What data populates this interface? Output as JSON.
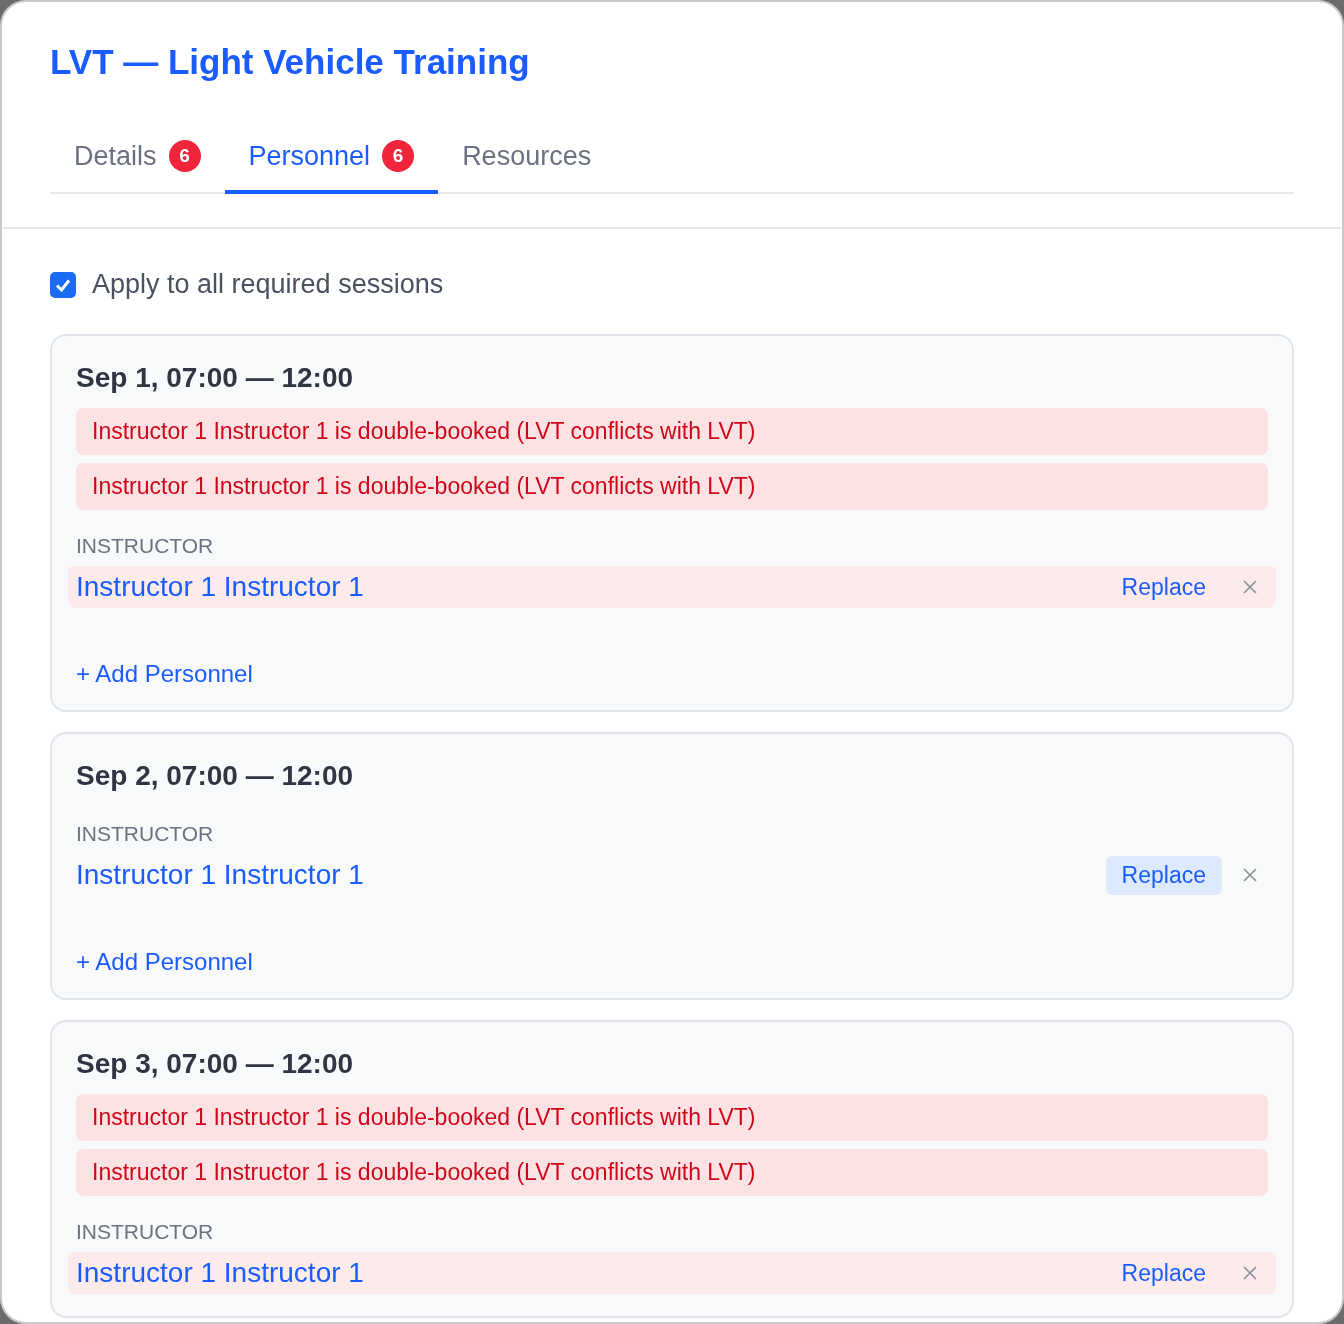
{
  "title": "LVT — Light Vehicle Training",
  "tabs": [
    {
      "label": "Details",
      "badge": "6",
      "selected": false
    },
    {
      "label": "Personnel",
      "badge": "6",
      "selected": true
    },
    {
      "label": "Resources",
      "selected": false
    }
  ],
  "apply_all": {
    "label": "Apply to all required sessions",
    "checked": true
  },
  "sessions": [
    {
      "date": "Sep 1, 07:00 — 12:00",
      "alerts": [
        "Instructor 1 Instructor 1 is double-booked (LVT conflicts with LVT)",
        "Instructor 1 Instructor 1 is double-booked (LVT conflicts with LVT)"
      ],
      "role": "INSTRUCTOR",
      "person": {
        "name": "Instructor 1 Instructor 1",
        "conflict": true,
        "replace": "Replace",
        "replace_hovered": false
      },
      "add": "+ Add Personnel"
    },
    {
      "date": "Sep 2, 07:00 — 12:00",
      "role": "INSTRUCTOR",
      "person": {
        "name": "Instructor 1 Instructor 1",
        "conflict": false,
        "replace": "Replace",
        "replace_hovered": true
      },
      "add": "+ Add Personnel"
    },
    {
      "date": "Sep 3, 07:00 — 12:00",
      "alerts": [
        "Instructor 1 Instructor 1 is double-booked (LVT conflicts with LVT)",
        "Instructor 1 Instructor 1 is double-booked (LVT conflicts with LVT)"
      ],
      "role": "INSTRUCTOR",
      "person": {
        "name": "Instructor 1 Instructor 1",
        "conflict": true,
        "replace": "Replace",
        "replace_hovered": false
      }
    }
  ]
}
